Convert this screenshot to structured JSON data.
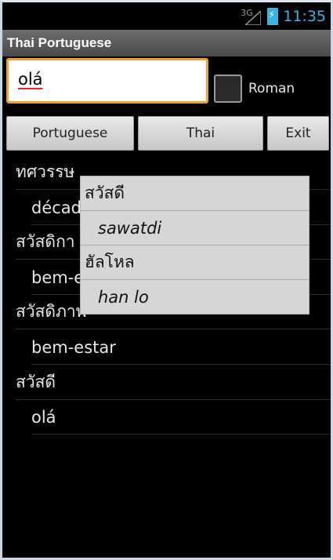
{
  "status": {
    "network": "3G",
    "time": "11:35"
  },
  "app": {
    "title": "Thai Portuguese"
  },
  "search": {
    "value": "olá"
  },
  "roman": {
    "label": "Roman",
    "checked": false
  },
  "buttons": {
    "portuguese": "Portuguese",
    "thai": "Thai",
    "exit": "Exit"
  },
  "results": [
    {
      "thai": "ทศวรรษ",
      "portuguese": "décad"
    },
    {
      "thai": "สวัสดิกา",
      "portuguese": "bem-e"
    },
    {
      "thai": "สวัสดิภาพ",
      "portuguese": "bem-estar"
    },
    {
      "thai": "สวัสดี",
      "portuguese": "olá"
    }
  ],
  "popup": [
    {
      "thai": "สวัสดี",
      "roman": "sawatdi"
    },
    {
      "thai": "ฮัลโหล",
      "roman": "han lo"
    }
  ]
}
